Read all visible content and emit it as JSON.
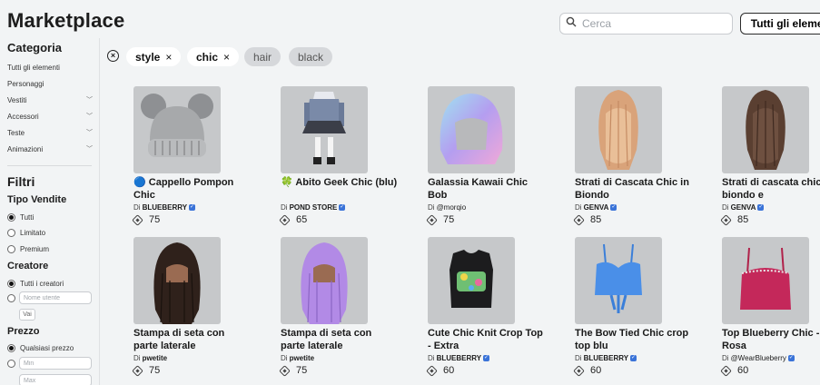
{
  "header": {
    "title": "Marketplace",
    "search_placeholder": "Cerca",
    "all_items_label": "Tutti gli elementi"
  },
  "sidebar": {
    "category_heading": "Categoria",
    "categories": [
      {
        "label": "Tutti gli elementi",
        "has_chevron": false
      },
      {
        "label": "Personaggi",
        "has_chevron": false
      },
      {
        "label": "Vestiti",
        "has_chevron": true
      },
      {
        "label": "Accessori",
        "has_chevron": true
      },
      {
        "label": "Teste",
        "has_chevron": true
      },
      {
        "label": "Animazioni",
        "has_chevron": true
      }
    ],
    "filters_heading": "Filtri",
    "sales_type": {
      "heading": "Tipo Vendite",
      "options": [
        "Tutti",
        "Limitato",
        "Premium"
      ],
      "selected": "Tutti"
    },
    "creator": {
      "heading": "Creatore",
      "options": [
        "Tutti i creatori"
      ],
      "selected": "Tutti i creatori",
      "username_placeholder": "Nome utente",
      "go_label": "Vai"
    },
    "price": {
      "heading": "Prezzo",
      "options": [
        "Qualsiasi prezzo"
      ],
      "selected": "Qualsiasi prezzo",
      "min_placeholder": "Min",
      "max_placeholder": "Max"
    }
  },
  "chips": [
    {
      "label": "style",
      "active": true
    },
    {
      "label": "chic",
      "active": true
    },
    {
      "label": "hair",
      "active": false
    },
    {
      "label": "black",
      "active": false
    }
  ],
  "items": [
    {
      "name": "🔵 Cappello Pompon Chic",
      "by_prefix": "Di",
      "creator": "BLUEBERRY",
      "verified": true,
      "price": "75",
      "icon": "beanie-hat"
    },
    {
      "name": "🍀 Abito Geek Chic (blu)",
      "by_prefix": "Di",
      "creator": "POND STORE",
      "verified": true,
      "price": "65",
      "icon": "geek-outfit"
    },
    {
      "name": "Galassia Kawaii Chic Bob",
      "by_prefix": "Di",
      "creator": "@morqio",
      "verified": false,
      "price": "75",
      "icon": "pastel-bob-hair"
    },
    {
      "name": "Strati di Cascata Chic in Biondo",
      "by_prefix": "Di",
      "creator": "GENVA",
      "verified": true,
      "price": "85",
      "icon": "blonde-layered-hair"
    },
    {
      "name": "Strati di cascata chic in biondo e",
      "by_prefix": "Di",
      "creator": "GENVA",
      "verified": true,
      "price": "85",
      "icon": "brown-layered-hair"
    },
    {
      "name": "Stampa di seta con parte laterale",
      "by_prefix": "Di",
      "creator": "pwetite",
      "verified": false,
      "price": "75",
      "icon": "dark-long-hair"
    },
    {
      "name": "Stampa di seta con parte laterale",
      "by_prefix": "Di",
      "creator": "pwetite",
      "verified": false,
      "price": "75",
      "icon": "purple-long-hair"
    },
    {
      "name": "Cute Chic Knit Crop Top - Extra",
      "by_prefix": "Di",
      "creator": "BLUEBERRY",
      "verified": true,
      "price": "60",
      "icon": "black-crop-top"
    },
    {
      "name": "The Bow Tied Chic crop top blu",
      "by_prefix": "Di",
      "creator": "BLUEBERRY",
      "verified": true,
      "price": "60",
      "icon": "blue-crop-top"
    },
    {
      "name": "Top Blueberry Chic - Rosa",
      "by_prefix": "Di",
      "creator": "@WearBlueberry",
      "verified": true,
      "price": "60",
      "icon": "pink-top"
    }
  ],
  "colors": {
    "background": "#f2f4f5",
    "thumb_bg": "#c6c8ca",
    "verified_badge": "#3a73d8"
  }
}
